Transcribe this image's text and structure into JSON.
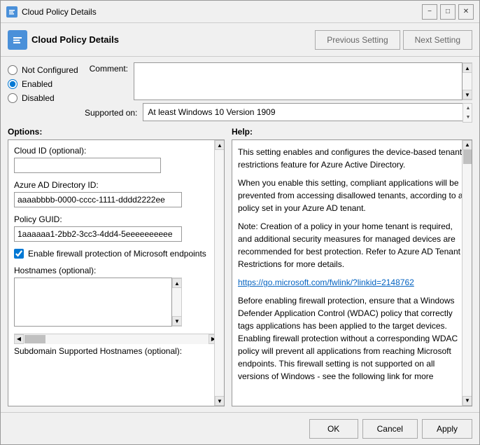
{
  "window": {
    "title": "Cloud Policy Details",
    "icon_label": "CP"
  },
  "toolbar": {
    "icon_label": "CP",
    "title": "Cloud Policy Details",
    "prev_btn": "Previous Setting",
    "next_btn": "Next Setting"
  },
  "radio_group": {
    "not_configured": "Not Configured",
    "enabled": "Enabled",
    "disabled": "Disabled"
  },
  "comment": {
    "label": "Comment:",
    "value": "",
    "placeholder": ""
  },
  "supported": {
    "label": "Supported on:",
    "value": "At least Windows 10 Version 1909"
  },
  "options": {
    "label": "Options:",
    "cloud_id_label": "Cloud ID (optional):",
    "cloud_id_value": "",
    "azure_ad_label": "Azure AD Directory ID:",
    "azure_ad_value": "aaaabbbb-0000-cccc-1111-dddd2222ee",
    "policy_guid_label": "Policy GUID:",
    "policy_guid_value": "1aaaaaa1-2bb2-3cc3-4dd4-5eeeeeeeeee",
    "firewall_checkbox_label": "Enable firewall protection of Microsoft endpoints",
    "firewall_checked": true,
    "hostnames_label": "Hostnames (optional):",
    "hostnames_value": "",
    "subdomain_label": "Subdomain Supported Hostnames (optional):"
  },
  "help": {
    "label": "Help:",
    "paragraphs": [
      "This setting enables and configures the device-based tenant restrictions feature for Azure Active Directory.",
      "When you enable this setting, compliant applications will be prevented from accessing disallowed tenants, according to a policy set in your Azure AD tenant.",
      "Note: Creation of a policy in your home tenant is required, and additional security measures for managed devices are recommended for best protection. Refer to Azure AD Tenant Restrictions for more details.",
      "https://go.microsoft.com/fwlink/?linkid=2148762",
      "Before enabling firewall protection, ensure that a Windows Defender Application Control (WDAC) policy that correctly tags applications has been applied to the target devices. Enabling firewall protection without a corresponding WDAC policy will prevent all applications from reaching Microsoft endpoints. This firewall setting is not supported on all versions of Windows - see the following link for more"
    ],
    "link": "https://go.microsoft.com/fwlink/?linkid=2148762"
  },
  "footer": {
    "ok_label": "OK",
    "cancel_label": "Cancel",
    "apply_label": "Apply"
  }
}
